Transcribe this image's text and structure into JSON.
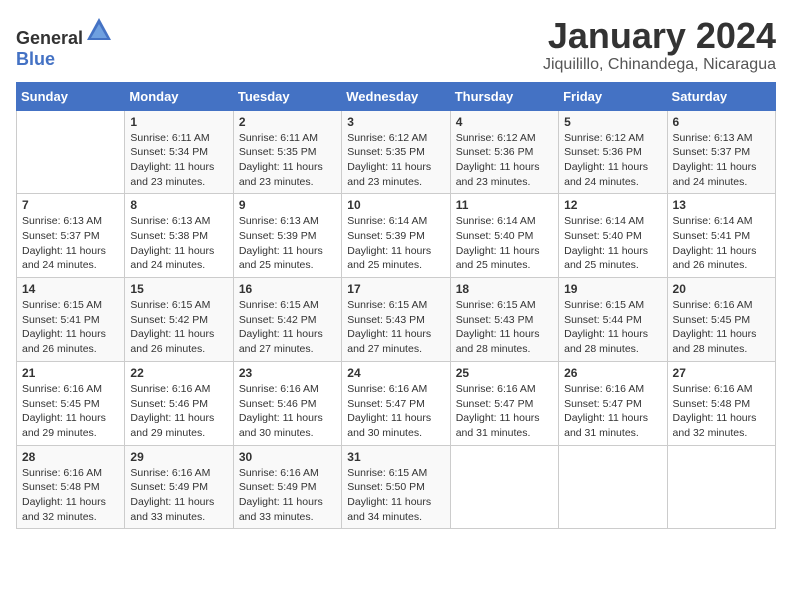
{
  "header": {
    "logo_general": "General",
    "logo_blue": "Blue",
    "title": "January 2024",
    "location": "Jiquilillo, Chinandega, Nicaragua"
  },
  "weekdays": [
    "Sunday",
    "Monday",
    "Tuesday",
    "Wednesday",
    "Thursday",
    "Friday",
    "Saturday"
  ],
  "weeks": [
    [
      {
        "day": "",
        "info": ""
      },
      {
        "day": "1",
        "info": "Sunrise: 6:11 AM\nSunset: 5:34 PM\nDaylight: 11 hours\nand 23 minutes."
      },
      {
        "day": "2",
        "info": "Sunrise: 6:11 AM\nSunset: 5:35 PM\nDaylight: 11 hours\nand 23 minutes."
      },
      {
        "day": "3",
        "info": "Sunrise: 6:12 AM\nSunset: 5:35 PM\nDaylight: 11 hours\nand 23 minutes."
      },
      {
        "day": "4",
        "info": "Sunrise: 6:12 AM\nSunset: 5:36 PM\nDaylight: 11 hours\nand 23 minutes."
      },
      {
        "day": "5",
        "info": "Sunrise: 6:12 AM\nSunset: 5:36 PM\nDaylight: 11 hours\nand 24 minutes."
      },
      {
        "day": "6",
        "info": "Sunrise: 6:13 AM\nSunset: 5:37 PM\nDaylight: 11 hours\nand 24 minutes."
      }
    ],
    [
      {
        "day": "7",
        "info": "Sunrise: 6:13 AM\nSunset: 5:37 PM\nDaylight: 11 hours\nand 24 minutes."
      },
      {
        "day": "8",
        "info": "Sunrise: 6:13 AM\nSunset: 5:38 PM\nDaylight: 11 hours\nand 24 minutes."
      },
      {
        "day": "9",
        "info": "Sunrise: 6:13 AM\nSunset: 5:39 PM\nDaylight: 11 hours\nand 25 minutes."
      },
      {
        "day": "10",
        "info": "Sunrise: 6:14 AM\nSunset: 5:39 PM\nDaylight: 11 hours\nand 25 minutes."
      },
      {
        "day": "11",
        "info": "Sunrise: 6:14 AM\nSunset: 5:40 PM\nDaylight: 11 hours\nand 25 minutes."
      },
      {
        "day": "12",
        "info": "Sunrise: 6:14 AM\nSunset: 5:40 PM\nDaylight: 11 hours\nand 25 minutes."
      },
      {
        "day": "13",
        "info": "Sunrise: 6:14 AM\nSunset: 5:41 PM\nDaylight: 11 hours\nand 26 minutes."
      }
    ],
    [
      {
        "day": "14",
        "info": "Sunrise: 6:15 AM\nSunset: 5:41 PM\nDaylight: 11 hours\nand 26 minutes."
      },
      {
        "day": "15",
        "info": "Sunrise: 6:15 AM\nSunset: 5:42 PM\nDaylight: 11 hours\nand 26 minutes."
      },
      {
        "day": "16",
        "info": "Sunrise: 6:15 AM\nSunset: 5:42 PM\nDaylight: 11 hours\nand 27 minutes."
      },
      {
        "day": "17",
        "info": "Sunrise: 6:15 AM\nSunset: 5:43 PM\nDaylight: 11 hours\nand 27 minutes."
      },
      {
        "day": "18",
        "info": "Sunrise: 6:15 AM\nSunset: 5:43 PM\nDaylight: 11 hours\nand 28 minutes."
      },
      {
        "day": "19",
        "info": "Sunrise: 6:15 AM\nSunset: 5:44 PM\nDaylight: 11 hours\nand 28 minutes."
      },
      {
        "day": "20",
        "info": "Sunrise: 6:16 AM\nSunset: 5:45 PM\nDaylight: 11 hours\nand 28 minutes."
      }
    ],
    [
      {
        "day": "21",
        "info": "Sunrise: 6:16 AM\nSunset: 5:45 PM\nDaylight: 11 hours\nand 29 minutes."
      },
      {
        "day": "22",
        "info": "Sunrise: 6:16 AM\nSunset: 5:46 PM\nDaylight: 11 hours\nand 29 minutes."
      },
      {
        "day": "23",
        "info": "Sunrise: 6:16 AM\nSunset: 5:46 PM\nDaylight: 11 hours\nand 30 minutes."
      },
      {
        "day": "24",
        "info": "Sunrise: 6:16 AM\nSunset: 5:47 PM\nDaylight: 11 hours\nand 30 minutes."
      },
      {
        "day": "25",
        "info": "Sunrise: 6:16 AM\nSunset: 5:47 PM\nDaylight: 11 hours\nand 31 minutes."
      },
      {
        "day": "26",
        "info": "Sunrise: 6:16 AM\nSunset: 5:47 PM\nDaylight: 11 hours\nand 31 minutes."
      },
      {
        "day": "27",
        "info": "Sunrise: 6:16 AM\nSunset: 5:48 PM\nDaylight: 11 hours\nand 32 minutes."
      }
    ],
    [
      {
        "day": "28",
        "info": "Sunrise: 6:16 AM\nSunset: 5:48 PM\nDaylight: 11 hours\nand 32 minutes."
      },
      {
        "day": "29",
        "info": "Sunrise: 6:16 AM\nSunset: 5:49 PM\nDaylight: 11 hours\nand 33 minutes."
      },
      {
        "day": "30",
        "info": "Sunrise: 6:16 AM\nSunset: 5:49 PM\nDaylight: 11 hours\nand 33 minutes."
      },
      {
        "day": "31",
        "info": "Sunrise: 6:15 AM\nSunset: 5:50 PM\nDaylight: 11 hours\nand 34 minutes."
      },
      {
        "day": "",
        "info": ""
      },
      {
        "day": "",
        "info": ""
      },
      {
        "day": "",
        "info": ""
      }
    ]
  ]
}
